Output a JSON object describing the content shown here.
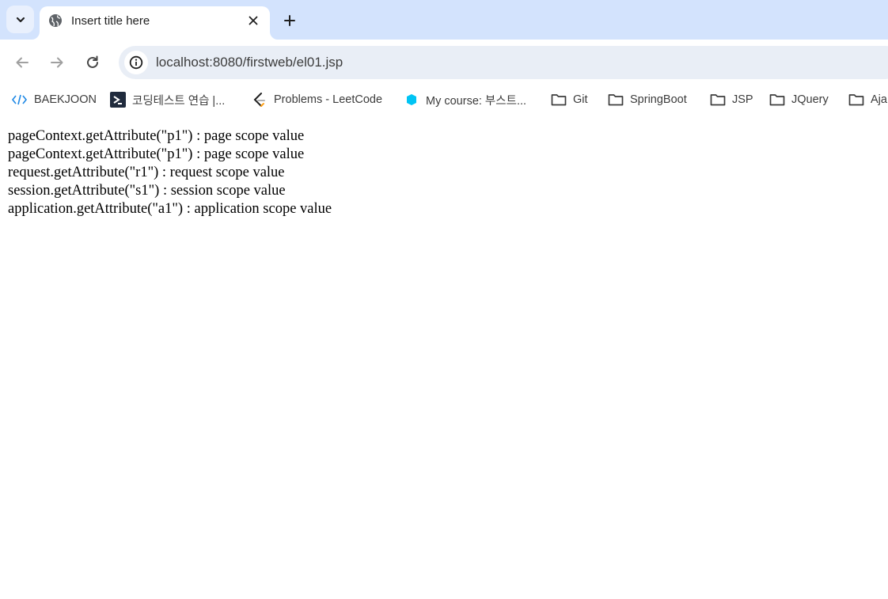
{
  "tab": {
    "title": "Insert title here"
  },
  "toolbar": {
    "url": "localhost:8080/firstweb/el01.jsp"
  },
  "bookmarks": [
    {
      "label": "BAEKJOON",
      "icon": "baekjoon-icon"
    },
    {
      "label": "코딩테스트 연습 |...",
      "icon": "programmers-icon"
    },
    {
      "label": "Problems - LeetCode",
      "icon": "leetcode-icon"
    },
    {
      "label": "My course: 부스트...",
      "icon": "boostcourse-icon"
    },
    {
      "label": "Git",
      "icon": "folder-icon"
    },
    {
      "label": "SpringBoot",
      "icon": "folder-icon"
    },
    {
      "label": "JSP",
      "icon": "folder-icon"
    },
    {
      "label": "JQuery",
      "icon": "folder-icon"
    },
    {
      "label": "Aja",
      "icon": "folder-icon"
    }
  ],
  "content": {
    "lines": [
      "pageContext.getAttribute(\"p1\") : page scope value",
      "pageContext.getAttribute(\"p1\") : page scope value",
      "request.getAttribute(\"r1\") : request scope value",
      "session.getAttribute(\"s1\") : session scope value",
      "application.getAttribute(\"a1\") : application scope value"
    ]
  },
  "colors": {
    "tabstrip": "#d3e3fd",
    "omnibox": "#e9eef6",
    "icon": "#474747",
    "boostcourse": "#00c4f4"
  }
}
